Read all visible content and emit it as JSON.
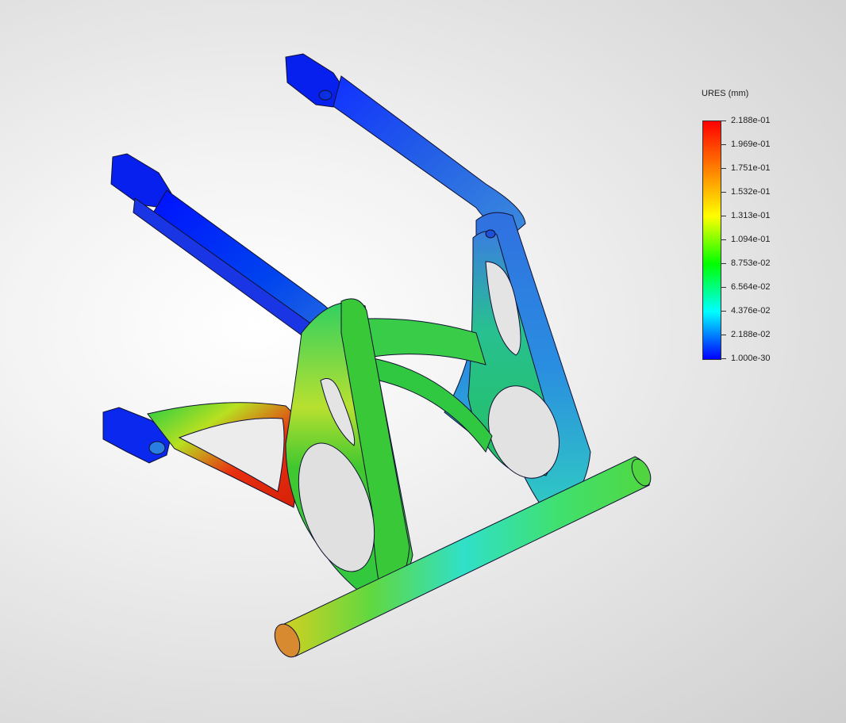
{
  "legend": {
    "title": "URES (mm)",
    "colors": [
      "#ff0000",
      "#ff7f00",
      "#ffff00",
      "#00ff00",
      "#00ffff",
      "#0000ff"
    ],
    "labels": [
      "2.188e-01",
      "1.969e-01",
      "1.751e-01",
      "1.532e-01",
      "1.313e-01",
      "1.094e-01",
      "8.753e-02",
      "6.564e-02",
      "4.376e-02",
      "2.188e-02",
      "1.000e-30"
    ]
  }
}
